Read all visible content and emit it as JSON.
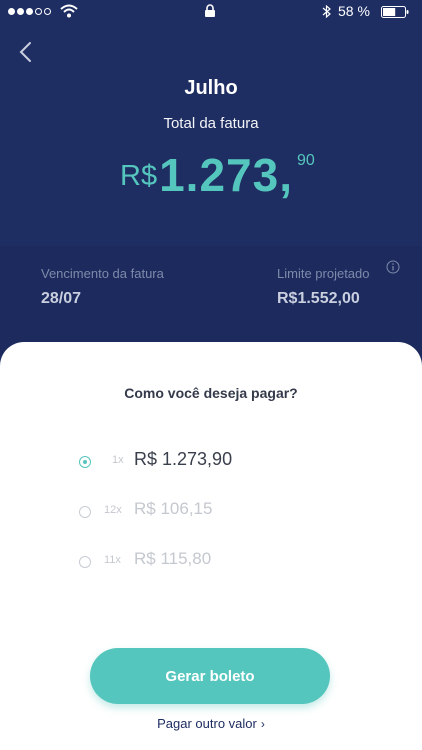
{
  "status_bar": {
    "battery_text": "58 %",
    "battery_level": 0.58,
    "signal_bars_filled": 3,
    "signal_bars_total": 5,
    "icons": [
      "wifi-icon",
      "lock-icon",
      "bluetooth-icon",
      "battery-icon"
    ]
  },
  "header": {
    "back_icon": "chevron-left-icon",
    "month": "Julho",
    "total_label": "Total da fatura",
    "currency": "R$",
    "amount_main": "1.273,",
    "amount_cents": "90"
  },
  "info": {
    "due_label": "Vencimento da fatura",
    "due_value": "28/07",
    "limit_label": "Limite projetado",
    "limit_value": "R$1.552,00",
    "info_icon": "info-icon"
  },
  "payment": {
    "question": "Como você deseja pagar?",
    "options": [
      {
        "count": "1x",
        "value": "R$ 1.273,90",
        "selected": true
      },
      {
        "count": "12x",
        "value": "R$ 106,15",
        "selected": false
      },
      {
        "count": "11x",
        "value": "R$ 115,80",
        "selected": false
      }
    ],
    "cta_label": "Gerar boleto",
    "other_label": "Pagar outro valor",
    "other_icon": "chevron-right-icon"
  },
  "colors": {
    "header_bg": "#1e2d62",
    "accent": "#55c6bd",
    "sheet_bg": "#ffffff"
  }
}
